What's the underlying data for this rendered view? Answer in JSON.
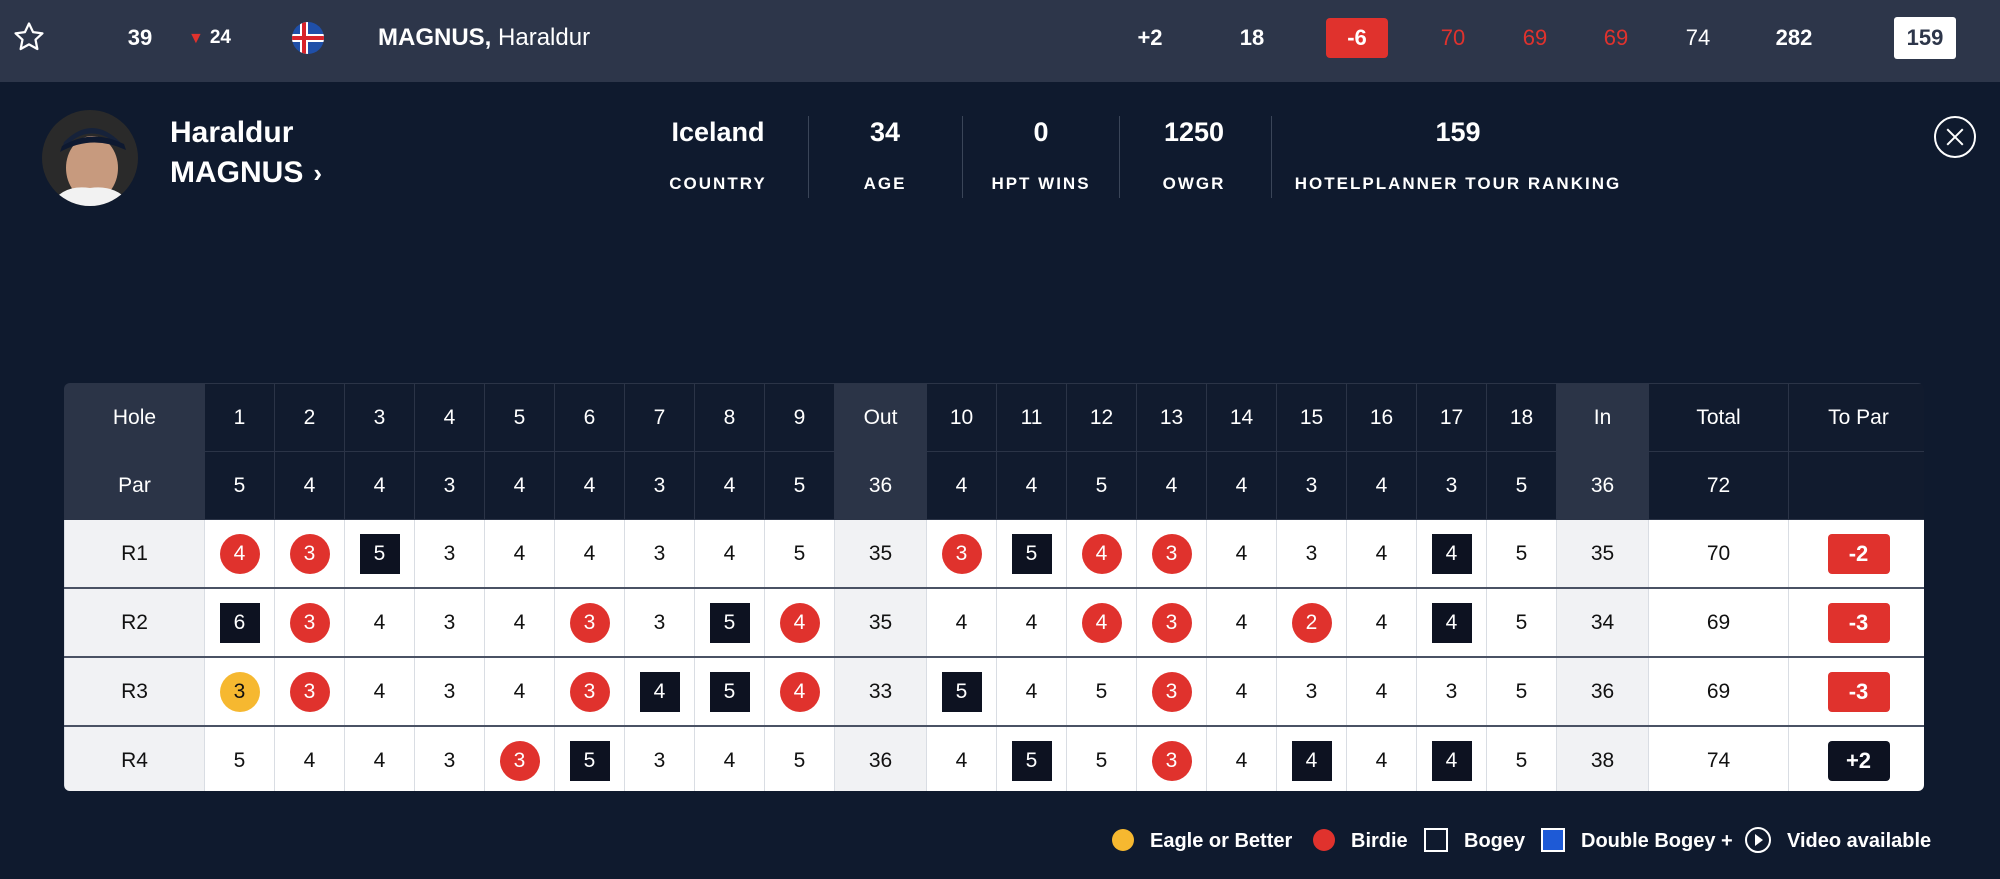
{
  "top_bar": {
    "position": "39",
    "movement": "24",
    "player_last": "MAGNUS,",
    "player_first": "Haraldur",
    "to_par": "+2",
    "thru": "18",
    "today": "-6",
    "rounds": [
      "70",
      "69",
      "69",
      "74"
    ],
    "total": "282",
    "ranking": "159"
  },
  "profile": {
    "first_name": "Haraldur",
    "last_name": "MAGNUS",
    "stats": [
      {
        "value": "Iceland",
        "label": "COUNTRY"
      },
      {
        "value": "34",
        "label": "AGE"
      },
      {
        "value": "0",
        "label": "HPT WINS"
      },
      {
        "value": "1250",
        "label": "OWGR"
      },
      {
        "value": "159",
        "label": "HOTELPLANNER TOUR RANKING"
      }
    ]
  },
  "scorecard": {
    "header": [
      "Hole",
      "1",
      "2",
      "3",
      "4",
      "5",
      "6",
      "7",
      "8",
      "9",
      "Out",
      "10",
      "11",
      "12",
      "13",
      "14",
      "15",
      "16",
      "17",
      "18",
      "In",
      "Total",
      "To Par"
    ],
    "par": [
      "Par",
      "5",
      "4",
      "4",
      "3",
      "4",
      "4",
      "3",
      "4",
      "5",
      "36",
      "4",
      "4",
      "5",
      "4",
      "4",
      "3",
      "4",
      "3",
      "5",
      "36",
      "72",
      ""
    ],
    "rounds": [
      {
        "label": "R1",
        "scores": [
          "4",
          "3",
          "5",
          "3",
          "4",
          "4",
          "3",
          "4",
          "5",
          "35",
          "3",
          "5",
          "4",
          "3",
          "4",
          "3",
          "4",
          "4",
          "5",
          "35",
          "70"
        ],
        "marks": [
          "birdie",
          "birdie",
          "bogey",
          "",
          "",
          "",
          "",
          "",
          "",
          "",
          "birdie",
          "bogey",
          "birdie",
          "birdie",
          "",
          "",
          "",
          "bogey",
          "",
          "",
          ""
        ],
        "to_par": "-2",
        "to_par_type": "under"
      },
      {
        "label": "R2",
        "scores": [
          "6",
          "3",
          "4",
          "3",
          "4",
          "3",
          "3",
          "5",
          "4",
          "35",
          "4",
          "4",
          "4",
          "3",
          "4",
          "2",
          "4",
          "4",
          "5",
          "34",
          "69"
        ],
        "marks": [
          "bogey",
          "birdie",
          "",
          "",
          "",
          "birdie",
          "",
          "bogey",
          "birdie",
          "",
          "",
          "",
          "birdie",
          "birdie",
          "",
          "birdie",
          "",
          "bogey",
          "",
          "",
          ""
        ],
        "to_par": "-3",
        "to_par_type": "under"
      },
      {
        "label": "R3",
        "scores": [
          "3",
          "3",
          "4",
          "3",
          "4",
          "3",
          "4",
          "5",
          "4",
          "33",
          "5",
          "4",
          "5",
          "3",
          "4",
          "3",
          "4",
          "3",
          "5",
          "36",
          "69"
        ],
        "marks": [
          "eagle",
          "birdie",
          "",
          "",
          "",
          "birdie",
          "bogey",
          "bogey",
          "birdie",
          "",
          "bogey",
          "",
          "",
          "birdie",
          "",
          "",
          "",
          "",
          "",
          "",
          ""
        ],
        "to_par": "-3",
        "to_par_type": "under"
      },
      {
        "label": "R4",
        "scores": [
          "5",
          "4",
          "4",
          "3",
          "3",
          "5",
          "3",
          "4",
          "5",
          "36",
          "4",
          "5",
          "5",
          "3",
          "4",
          "4",
          "4",
          "4",
          "5",
          "38",
          "74"
        ],
        "marks": [
          "",
          "",
          "",
          "",
          "birdie",
          "bogey",
          "",
          "",
          "",
          "",
          "",
          "bogey",
          "",
          "birdie",
          "",
          "bogey",
          "",
          "bogey",
          "",
          "",
          ""
        ],
        "to_par": "+2",
        "to_par_type": "over"
      }
    ]
  },
  "legend": [
    {
      "key": "eagle",
      "label": "Eagle or Better"
    },
    {
      "key": "birdie",
      "label": "Birdie"
    },
    {
      "key": "bogey",
      "label": "Bogey"
    },
    {
      "key": "dbogey",
      "label": "Double Bogey +"
    },
    {
      "key": "video",
      "label": "Video available"
    }
  ],
  "colors": {
    "background": "#0f1a2e",
    "top_bar": "#2d364a",
    "birdie": "#e0322d",
    "eagle": "#f6b830",
    "bogey": "#0d1221",
    "double_bogey": "#1e5ad6"
  }
}
